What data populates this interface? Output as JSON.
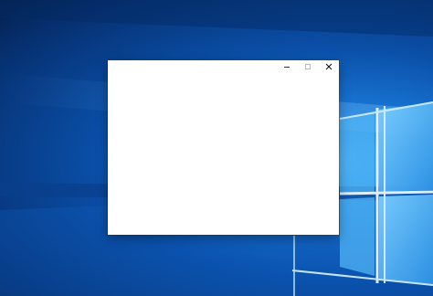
{
  "desktop": {
    "wallpaper": "windows-10-light-wallpaper",
    "colors": {
      "accent": "#1a78d8",
      "dark": "#062f6e",
      "glow": "#bfe6ff"
    }
  },
  "window": {
    "title": "",
    "background": "#ffffff",
    "controls": {
      "minimize_icon": "minimize-icon",
      "maximize_icon": "maximize-icon",
      "close_icon": "close-icon"
    }
  }
}
